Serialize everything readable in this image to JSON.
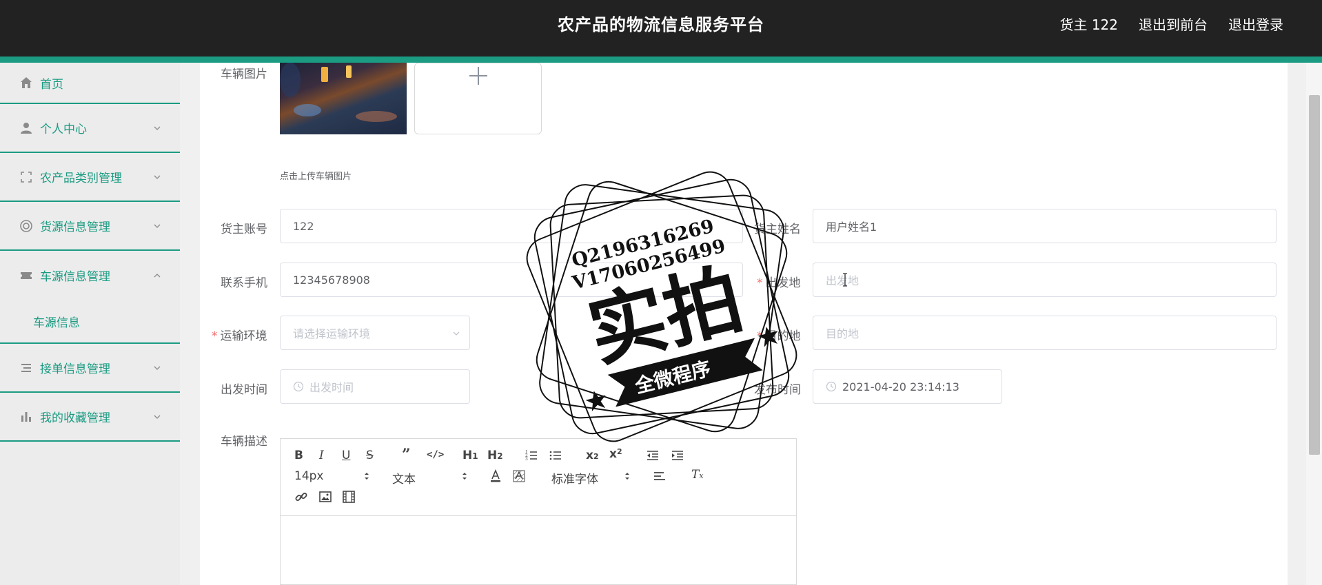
{
  "header": {
    "title": "农产品的物流信息服务平台",
    "user_label": "货主 122",
    "exit_front_label": "退出到前台",
    "logout_label": "退出登录"
  },
  "sidebar": {
    "items": [
      {
        "label": "首页",
        "icon": "home-icon"
      },
      {
        "label": "个人中心",
        "icon": "user-icon"
      },
      {
        "label": "农产品类别管理",
        "icon": "fullscreen-icon"
      },
      {
        "label": "货源信息管理",
        "icon": "lifebuoy-icon"
      },
      {
        "label": "车源信息管理",
        "icon": "ticket-icon",
        "expanded": true
      },
      {
        "label": "接单信息管理",
        "icon": "list-icon"
      },
      {
        "label": "我的收藏管理",
        "icon": "bar-chart-icon"
      }
    ],
    "sub_items": [
      {
        "label": "车源信息"
      }
    ]
  },
  "form": {
    "vehicle_image_label": "车辆图片",
    "upload_hint": "点击上传车辆图片",
    "owner_account_label": "货主账号",
    "owner_account_value": "122",
    "owner_name_label": "货主姓名",
    "owner_name_value": "用户姓名1",
    "phone_label": "联系手机",
    "phone_value": "12345678908",
    "origin_label": "出发地",
    "origin_placeholder": "出发地",
    "transport_env_label": "运输环境",
    "transport_env_placeholder": "请选择运输环境",
    "destination_label": "目的地",
    "destination_placeholder": "目的地",
    "depart_time_label": "出发时间",
    "depart_time_placeholder": "出发时间",
    "publish_time_label": "发布时间",
    "publish_time_value": "2021-04-20 23:14:13",
    "vehicle_desc_label": "车辆描述"
  },
  "editor": {
    "font_size": "14px",
    "block_type": "文本",
    "font_family": "标准字体",
    "h1": "H1",
    "h2": "H2"
  },
  "watermark": {
    "line1": "Q2196316269",
    "line2": "V17060256499",
    "big_text": "实拍",
    "ribbon_text": "全微程序"
  },
  "colors": {
    "accent": "#1a9b82",
    "topbar": "#222222",
    "required": "#f56c6c"
  }
}
